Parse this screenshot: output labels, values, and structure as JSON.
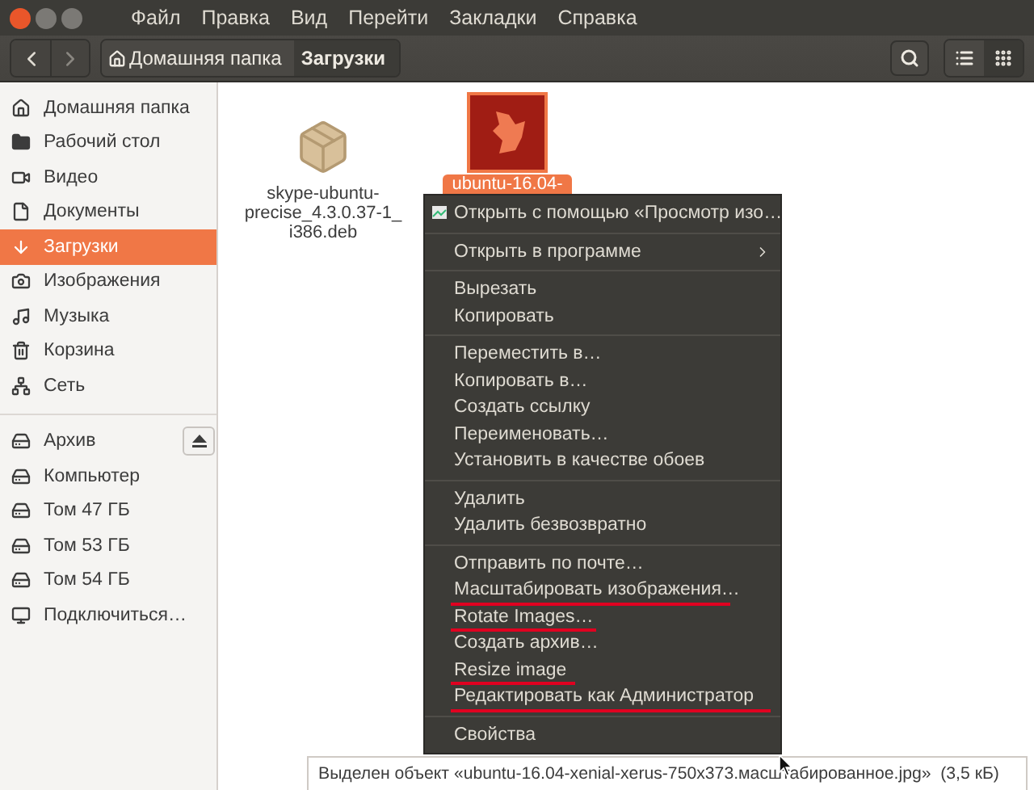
{
  "menubar": [
    "Файл",
    "Правка",
    "Вид",
    "Перейти",
    "Закладки",
    "Справка"
  ],
  "breadcrumbs": [
    {
      "label": "Домашняя папка",
      "kind": "home",
      "selected": false
    },
    {
      "label": "Загрузки",
      "kind": "folder",
      "selected": true
    }
  ],
  "view_modes": [
    {
      "kind": "list",
      "selected": false
    },
    {
      "kind": "grid",
      "selected": true
    }
  ],
  "sidebar": {
    "places": [
      {
        "label": "Домашняя папка",
        "selected": false
      },
      {
        "label": "Рабочий стол",
        "selected": false
      },
      {
        "label": "Видео",
        "selected": false
      },
      {
        "label": "Документы",
        "selected": false
      },
      {
        "label": "Загрузки",
        "selected": true
      },
      {
        "label": "Изображения",
        "selected": false
      },
      {
        "label": "Музыка",
        "selected": false
      },
      {
        "label": "Корзина",
        "selected": false
      },
      {
        "label": "Сеть",
        "selected": false
      }
    ],
    "devices": [
      {
        "label": "Архив",
        "eject": true
      },
      {
        "label": "Компьютер",
        "eject": false
      },
      {
        "label": "Том 47 ГБ",
        "eject": false
      },
      {
        "label": "Том 53 ГБ",
        "eject": false
      },
      {
        "label": "Том 54 ГБ",
        "eject": false
      },
      {
        "label": "Подключиться…",
        "eject": false
      }
    ]
  },
  "files": [
    {
      "name_lines": [
        "skype-ubuntu-",
        "precise_4.3.0.37-1_",
        "i386.deb"
      ],
      "kind": "package",
      "selected": false
    },
    {
      "name_lines": [
        "ubuntu-16.04-"
      ],
      "kind": "image",
      "selected": true
    }
  ],
  "context_menu": [
    [
      {
        "label": "Открыть с помощью «Просмотр изо…",
        "kind": "app",
        "underlined": false
      }
    ],
    [
      {
        "label": "Открыть в программе",
        "kind": "submenu",
        "underlined": false
      }
    ],
    [
      {
        "label": "Вырезать",
        "kind": "plain",
        "underlined": false
      },
      {
        "label": "Копировать",
        "kind": "plain",
        "underlined": false
      }
    ],
    [
      {
        "label": "Переместить в…",
        "kind": "plain",
        "underlined": false
      },
      {
        "label": "Копировать в…",
        "kind": "plain",
        "underlined": false
      },
      {
        "label": "Создать ссылку",
        "kind": "plain",
        "underlined": false
      },
      {
        "label": "Переименовать…",
        "kind": "plain",
        "underlined": false
      },
      {
        "label": "Установить в качестве обоев",
        "kind": "plain",
        "underlined": false
      }
    ],
    [
      {
        "label": "Удалить",
        "kind": "plain",
        "underlined": false
      },
      {
        "label": "Удалить безвозвратно",
        "kind": "plain",
        "underlined": false
      }
    ],
    [
      {
        "label": "Отправить по почте…",
        "kind": "plain",
        "underlined": false
      },
      {
        "label": "Масштабировать изображения…",
        "kind": "plain",
        "underlined": true
      },
      {
        "label": "Rotate Images…",
        "kind": "plain",
        "underlined": true
      },
      {
        "label": "Создать архив…",
        "kind": "plain",
        "underlined": false
      },
      {
        "label": "Resize image",
        "kind": "plain",
        "underlined": true
      },
      {
        "label": "Редактировать как Администратор",
        "kind": "plain",
        "underlined": true
      }
    ],
    [
      {
        "label": "Свойства",
        "kind": "plain",
        "underlined": false
      }
    ]
  ],
  "status": "Выделен объект «ubuntu-16.04-xenial-xerus-750x373.масштабированное.jpg»  (3,5 кБ)"
}
